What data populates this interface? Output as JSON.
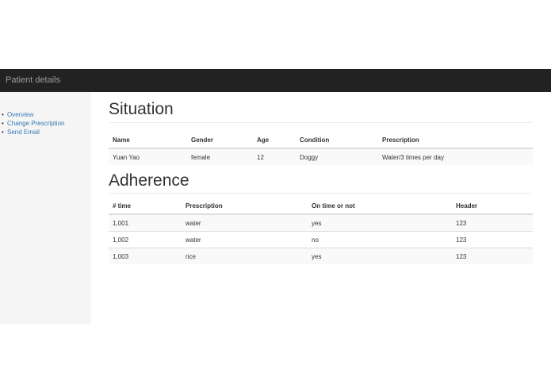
{
  "navbar": {
    "brand": "Patient details"
  },
  "sidebar": {
    "items": [
      {
        "label": "Overview"
      },
      {
        "label": "Change Prescription"
      },
      {
        "label": "Send Email"
      }
    ]
  },
  "situation": {
    "title": "Situation",
    "columns": [
      "Name",
      "Gender",
      "Age",
      "Condition",
      "Prescription"
    ],
    "rows": [
      [
        "Yuan Yao",
        "female",
        "12",
        "Doggy",
        "Water/3 times per day"
      ]
    ]
  },
  "adherence": {
    "title": "Adherence",
    "columns": [
      "# time",
      "Prescription",
      "On time or not",
      "Header"
    ],
    "rows": [
      [
        "1,001",
        "water",
        "yes",
        "123"
      ],
      [
        "1,002",
        "water",
        "no",
        "123"
      ],
      [
        "1,003",
        "rice",
        "yes",
        "123"
      ]
    ]
  },
  "colors": {
    "navbar_bg": "#222222",
    "link": "#337ab7",
    "sidebar_bg": "#f5f5f5"
  }
}
